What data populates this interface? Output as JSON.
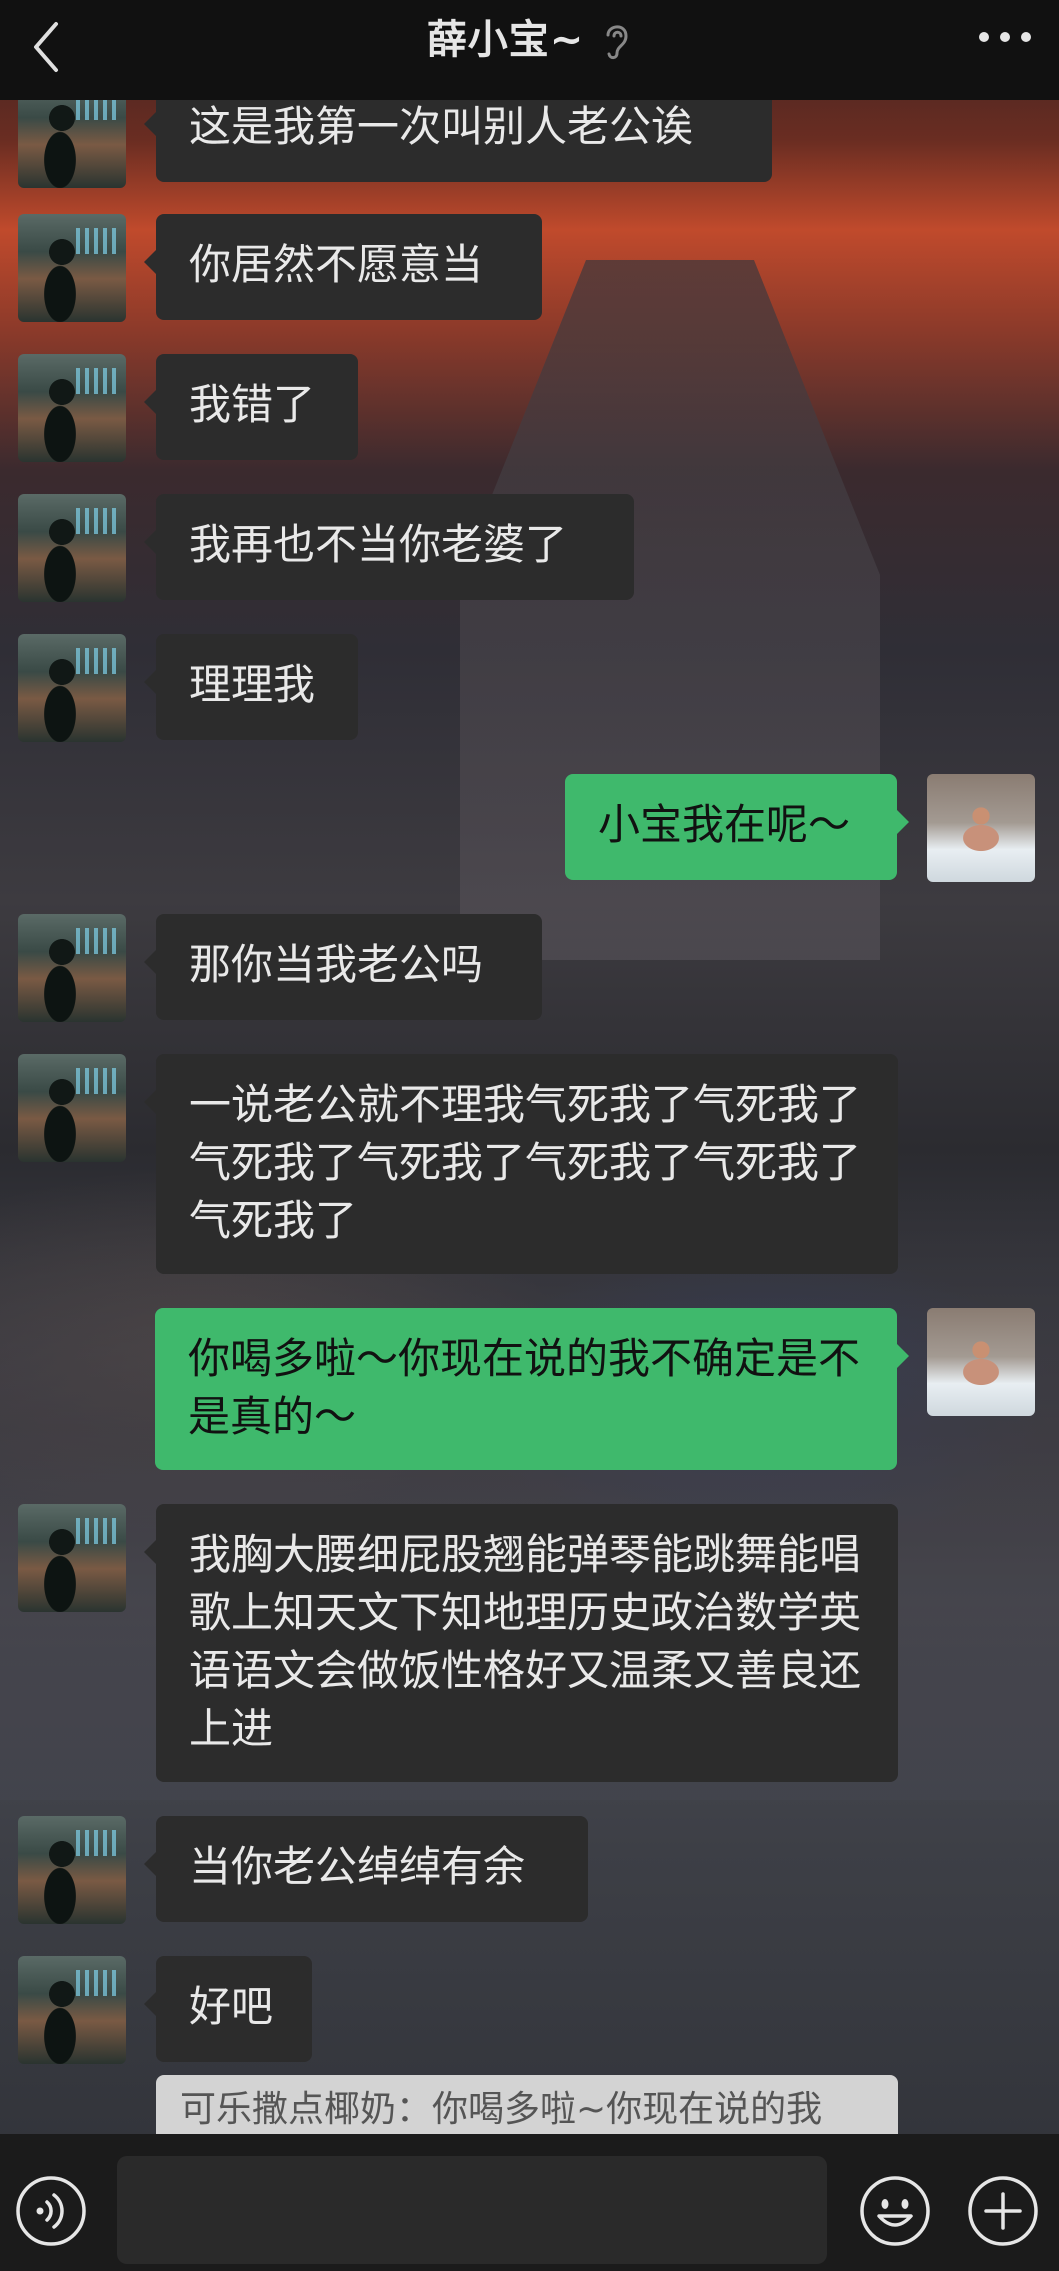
{
  "header": {
    "title": "薛小宝~",
    "back_icon": "chevron-left-icon",
    "ear_icon": "ear-icon",
    "more_icon": "ellipsis-icon"
  },
  "messages": [
    {
      "side": "left",
      "text": "这是我第一次叫别人老公诶"
    },
    {
      "side": "left",
      "text": "你居然不愿意当"
    },
    {
      "side": "left",
      "text": "我错了"
    },
    {
      "side": "left",
      "text": "我再也不当你老婆了"
    },
    {
      "side": "left",
      "text": "理理我"
    },
    {
      "side": "right",
      "text": "小宝我在呢～"
    },
    {
      "side": "left",
      "text": "那你当我老公吗"
    },
    {
      "side": "left",
      "text": "一说老公就不理我气死我了气死我了气死我了气死我了气死我了气死我了气死我了"
    },
    {
      "side": "right",
      "text": "你喝多啦～你现在说的我不确定是不是真的～"
    },
    {
      "side": "left",
      "text": "我胸大腰细屁股翘能弹琴能跳舞能唱歌上知天文下知地理历史政治数学英语语文会做饭性格好又温柔又善良还上进"
    },
    {
      "side": "left",
      "text": "当你老公绰绰有余"
    },
    {
      "side": "left",
      "text": "好吧"
    }
  ],
  "quoted_reply": "可乐撒点椰奶：你喝多啦~你现在说的我",
  "input_bar": {
    "voice_icon": "voice-icon",
    "emoji_icon": "emoji-icon",
    "plus_icon": "plus-icon"
  },
  "colors": {
    "bubble_self": "#3fb96c",
    "bubble_other": "#2c2c2c",
    "bar_background": "#111111"
  }
}
